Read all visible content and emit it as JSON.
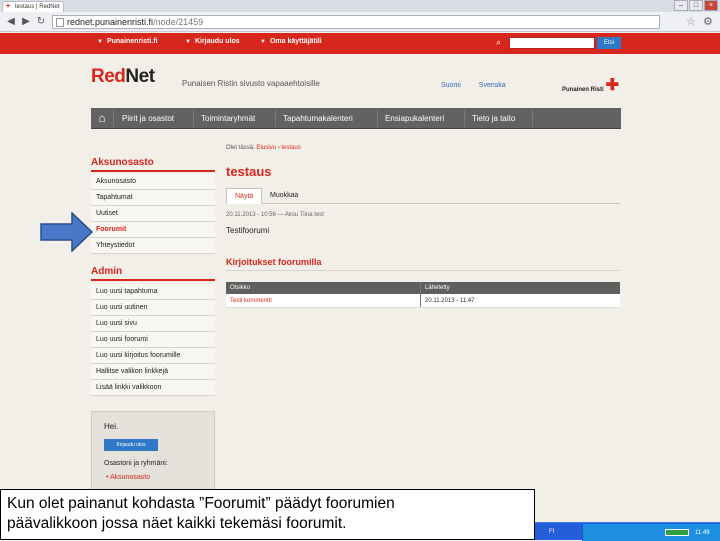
{
  "browser": {
    "tab_title": "testaus | RedNet",
    "url_host": "rednet.punainenristi.fi",
    "url_path": "/node/21459",
    "back_icon": "back-arrow-icon",
    "forward_icon": "forward-arrow-icon",
    "reload_icon": "reload-icon"
  },
  "topbar": {
    "links": [
      "Punainenristi.fi",
      "Kirjaudu ulos",
      "Oma käyttäjätili"
    ],
    "search_placeholder": "",
    "search_button": "Etsi",
    "bg_color": "#d7261c"
  },
  "header": {
    "logo_red": "Red",
    "logo_dark": "Net",
    "tagline": "Punaisen Ristin sivusto vapaaehtoisille",
    "links": [
      "Suomi",
      "Svenska"
    ],
    "brand": "Punainen Risti"
  },
  "mainnav": {
    "items": [
      "Piirit ja osastot",
      "Toimintaryhmät",
      "Tapahtumakalenteri",
      "Ensiapukalenteri",
      "Tieto ja taito"
    ]
  },
  "sidebar": {
    "section_title": "Aksunosasto",
    "items": [
      "Aksunosasto",
      "Tapahtumat",
      "Uutiset",
      "Foorumit",
      "Yhteystiedot"
    ],
    "active_index": 3,
    "admin_title": "Admin",
    "admin_items": [
      "Luo uusi tapahtuma",
      "Luo uusi uutinen",
      "Luo uusi sivu",
      "Luo uusi foorumi",
      "Luo uusi kirjoitus foorumille",
      "Hallitse valikon linkkejä",
      "Lisää linkki valikkoon"
    ]
  },
  "userbox": {
    "greeting": "Hei.",
    "logout": "Kirjaudu ulos",
    "groups_label": "Osastoni ja ryhmäni:",
    "group_item": "Aksunosasto"
  },
  "content": {
    "breadcrumb_label": "Olet tässä:",
    "breadcrumb_path": "Etusivu › testaus",
    "title": "testaus",
    "tabs": [
      "Näytä",
      "Muokkaa"
    ],
    "meta": "20.11.2013 - 10:56 — Aksu Tiina test",
    "body": "Testifoorumi",
    "section_title": "Kirjoitukset foorumilla",
    "table": {
      "headers": [
        "Otsikko",
        "Lähetetty"
      ],
      "rows": [
        [
          "Testi kommentti",
          "20.11.2013 - 11:47"
        ]
      ]
    }
  },
  "caption": {
    "line1": "Kun olet painanut kohdasta ”Foorumit” päädyt foorumien",
    "line2": "päävalikkoon jossa näet kaikki tekemäsi foorumit."
  },
  "taskbar": {
    "lang": "FI",
    "clock": "11:49"
  }
}
